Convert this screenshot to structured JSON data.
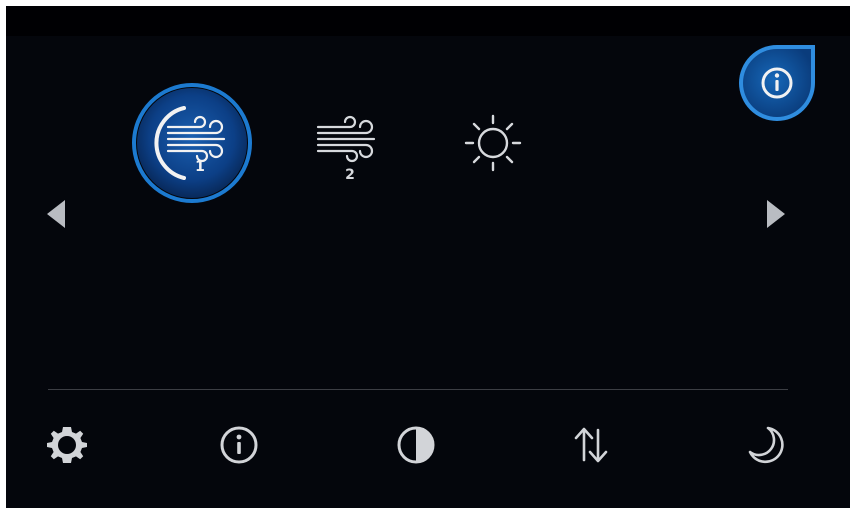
{
  "colors": {
    "screen_background": "#04060c",
    "selected_ring": "#1e6fc0",
    "selected_fill": "#0b3b7a",
    "icon_primary": "#e8e8e8",
    "icon_muted": "#b9bcc2",
    "accent": "#2f8de0"
  },
  "modes": [
    {
      "id": "fan-speed-1",
      "icon": "wind-icon",
      "number": "1",
      "selected": true
    },
    {
      "id": "fan-speed-2",
      "icon": "wind-icon",
      "number": "2",
      "selected": false
    },
    {
      "id": "sunny",
      "icon": "sun-icon",
      "selected": false
    }
  ],
  "navigation": {
    "left_icon": "triangle-left-icon",
    "right_icon": "triangle-right-icon"
  },
  "corner_button": {
    "icon": "info-icon"
  },
  "toolbar": [
    {
      "id": "settings",
      "icon": "gear-icon"
    },
    {
      "id": "info",
      "icon": "info-icon"
    },
    {
      "id": "contrast",
      "icon": "contrast-icon"
    },
    {
      "id": "sort",
      "icon": "up-down-arrows-icon"
    },
    {
      "id": "night",
      "icon": "moon-icon"
    }
  ]
}
